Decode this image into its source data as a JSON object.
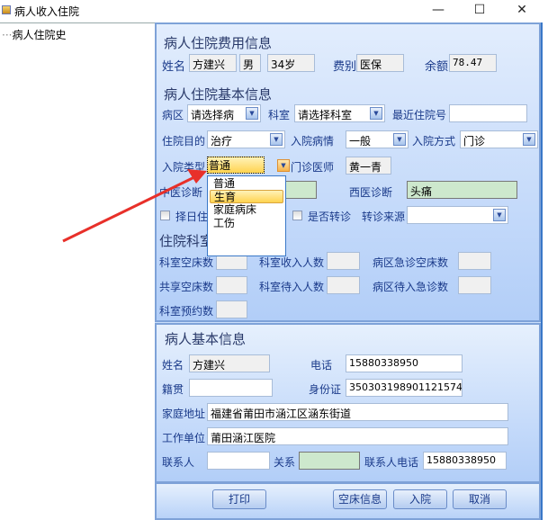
{
  "window": {
    "title": "病人收入住院",
    "minimize": "—",
    "maximize": "☐",
    "close": "✕"
  },
  "tree": {
    "items": [
      "病人住院史"
    ]
  },
  "fee": {
    "title": "病人住院费用信息",
    "name_label": "姓名",
    "name": "方建兴",
    "sex": "男",
    "age": "34岁",
    "fee_type_label": "费别",
    "fee_type": "医保",
    "balance_label": "余额",
    "balance": "78.47"
  },
  "basic": {
    "title": "病人住院基本信息",
    "ward_label": "病区",
    "ward": "请选择病",
    "dept_label": "科室",
    "dept": "请选择科室",
    "recent_no_label": "最近住院号",
    "recent_no": "",
    "purpose_label": "住院目的",
    "purpose": "治疗",
    "condition_label": "入院病情",
    "condition": "一般",
    "method_label": "入院方式",
    "method": "门诊",
    "type_label": "入院类型",
    "type": "普通",
    "doctor_label": "门诊医师",
    "doctor": "黄一青",
    "type_options": [
      "普通",
      "生育",
      "家庭病床",
      "工伤"
    ],
    "type_highlighted": "生育",
    "tcm_label": "中医诊断",
    "tcm": "",
    "wm_label": "西医诊断",
    "wm": "头痛",
    "schedule_label": "择日住院",
    "transfer_label": "是否转诊",
    "transfer_source_label": "转诊来源",
    "transfer_source": ""
  },
  "beds": {
    "title": "住院科室床位情况",
    "dept_empty": "科室空床数",
    "dept_admit": "科室收入人数",
    "ward_er_empty": "病区急诊空床数",
    "shared_empty": "共享空床数",
    "dept_waiting": "科室待入人数",
    "ward_er_waiting": "病区待入急诊数",
    "dept_reserve": "科室预约数"
  },
  "patient": {
    "title": "病人基本信息",
    "name_label": "姓名",
    "name": "方建兴",
    "phone_label": "电话",
    "phone": "15880338950",
    "native_label": "籍贯",
    "native": "",
    "id_label": "身份证",
    "id": "350303198901121574",
    "address_label": "家庭地址",
    "address": "福建省莆田市涵江区涵东街道",
    "work_label": "工作单位",
    "work": "莆田涵江医院",
    "contact_label": "联系人",
    "contact": "",
    "relation_label": "关系",
    "relation": "",
    "contact_phone_label": "联系人电话",
    "contact_phone": "15880338950"
  },
  "buttons": {
    "print": "打印",
    "empty_beds": "空床信息",
    "admit": "入院",
    "cancel": "取消"
  },
  "annotation": {
    "arrow_color": "#e8302a"
  }
}
